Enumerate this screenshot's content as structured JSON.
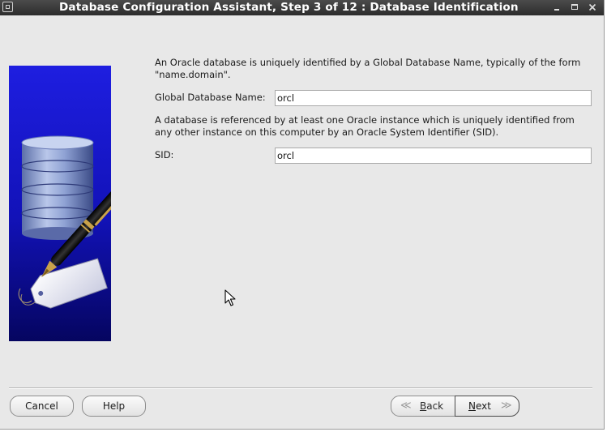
{
  "window": {
    "title": "Database Configuration Assistant, Step 3 of 12 : Database Identification"
  },
  "form": {
    "intro_text_line1": "An Oracle database is uniquely identified by a Global Database Name, typically of the form",
    "intro_text_line2": "\"name.domain\".",
    "global_db_name_label": "Global Database Name:",
    "global_db_name_value": "orcl",
    "sid_description_line1": "A database is referenced by at least one Oracle instance which is uniquely identified from",
    "sid_description_line2": "any other instance on this computer by an Oracle System Identifier (SID).",
    "sid_label": "SID:",
    "sid_value": "orcl"
  },
  "buttons": {
    "cancel": "Cancel",
    "help": "Help",
    "back_mnemonic": "B",
    "back_rest": "ack",
    "next_mnemonic": "N",
    "next_rest": "ext"
  },
  "icons": {
    "illustration": "database-cylinder-with-pen-and-tag",
    "back_arrow": "double-chevron-left-icon",
    "next_arrow": "double-chevron-right-icon"
  },
  "colors": {
    "illustration_blue": "#1a1ad0",
    "titlebar": "#333333",
    "background": "#e8e8e8"
  }
}
